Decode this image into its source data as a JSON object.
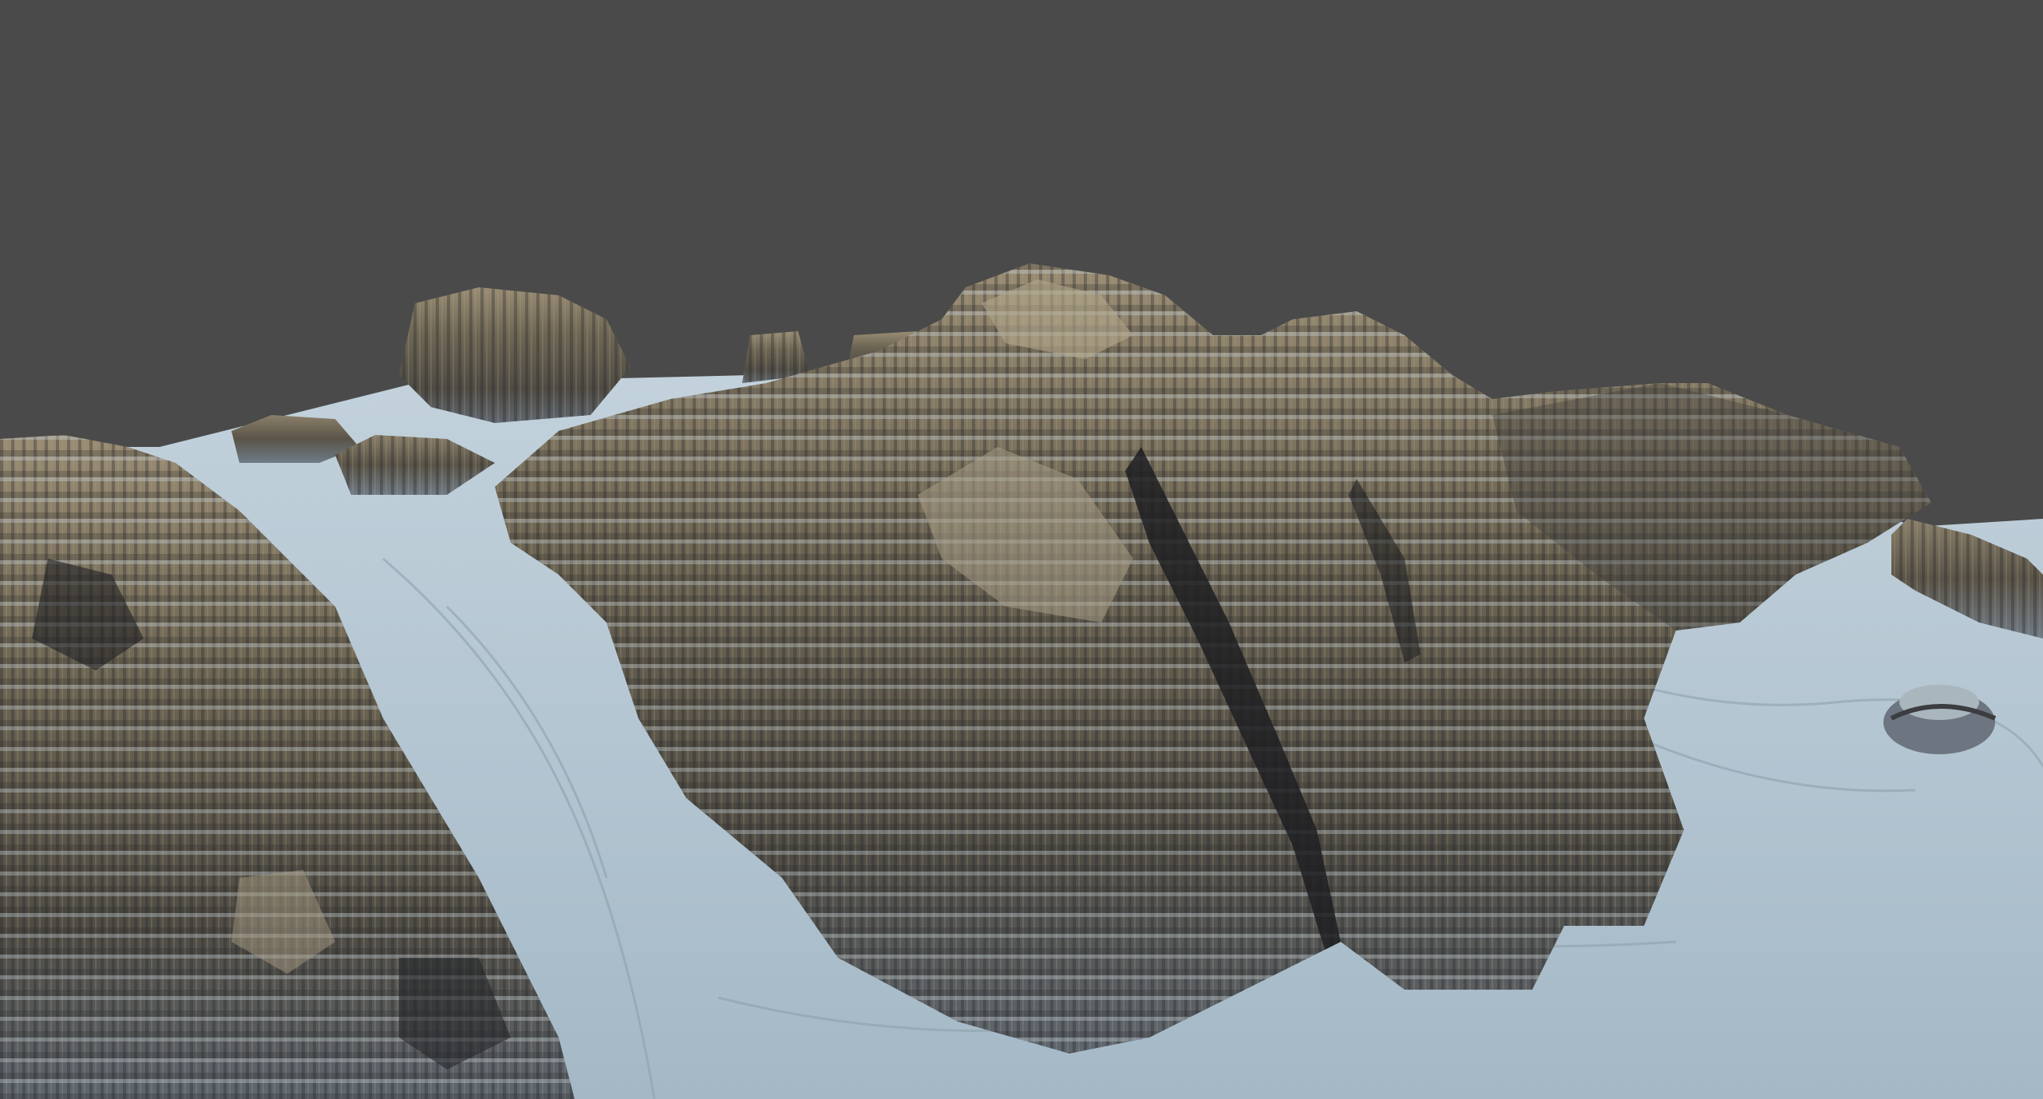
{
  "scene": {
    "background_color": "#4a4a4a",
    "terrain_colors": {
      "snow": "#b9cbd6",
      "snow_shadow": "#8fa3b1",
      "rock_light": "#8f8470",
      "rock_mid": "#6b6252",
      "rock_dark": "#3d3a35",
      "rock_shadow": "#24252a"
    }
  }
}
